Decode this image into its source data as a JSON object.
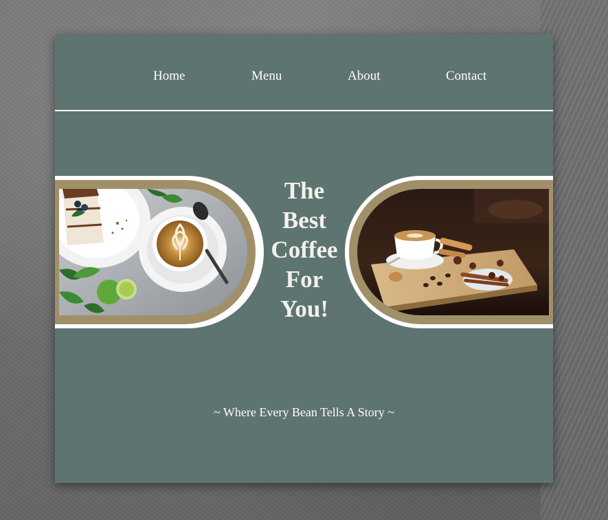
{
  "nav": {
    "items": [
      "Home",
      "Menu",
      "About",
      "Contact"
    ]
  },
  "hero": {
    "title_lines": [
      "The",
      "Best",
      "Coffee",
      "For",
      "You!"
    ]
  },
  "tagline": "~ Where Every Bean Tells A Story ~",
  "colors": {
    "card_background": "#5e7470",
    "accent_gold": "#a0906a",
    "text": "#ffffff"
  }
}
